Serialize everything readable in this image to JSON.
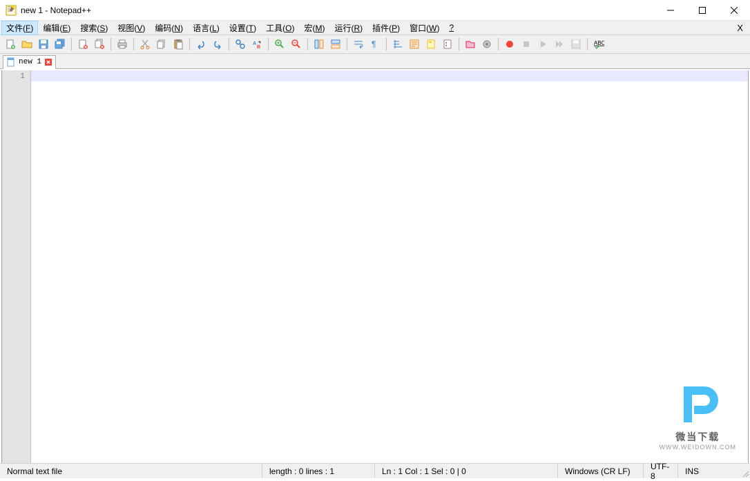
{
  "window": {
    "title": "new 1 - Notepad++"
  },
  "menu": {
    "items": [
      {
        "label": "文件(",
        "key": "F",
        "suffix": ")"
      },
      {
        "label": "编辑(",
        "key": "E",
        "suffix": ")"
      },
      {
        "label": "搜索(",
        "key": "S",
        "suffix": ")"
      },
      {
        "label": "视图(",
        "key": "V",
        "suffix": ")"
      },
      {
        "label": "编码(",
        "key": "N",
        "suffix": ")"
      },
      {
        "label": "语言(",
        "key": "L",
        "suffix": ")"
      },
      {
        "label": "设置(",
        "key": "T",
        "suffix": ")"
      },
      {
        "label": "工具(",
        "key": "O",
        "suffix": ")"
      },
      {
        "label": "宏(",
        "key": "M",
        "suffix": ")"
      },
      {
        "label": "运行(",
        "key": "R",
        "suffix": ")"
      },
      {
        "label": "插件(",
        "key": "P",
        "suffix": ")"
      },
      {
        "label": "窗口(",
        "key": "W",
        "suffix": ")"
      },
      {
        "label": "",
        "key": "?",
        "suffix": ""
      }
    ],
    "closeX": "X"
  },
  "tabs": {
    "tab1": "new 1"
  },
  "editor": {
    "line1": "1"
  },
  "status": {
    "filetype": "Normal text file",
    "length": "length : 0    lines : 1",
    "pos": "Ln : 1    Col : 1    Sel : 0 | 0",
    "eol": "Windows (CR LF)",
    "encoding": "UTF-8",
    "mode": "INS"
  },
  "watermark": {
    "text": "微当下载",
    "url": "WWW.WEIDOWN.COM"
  }
}
